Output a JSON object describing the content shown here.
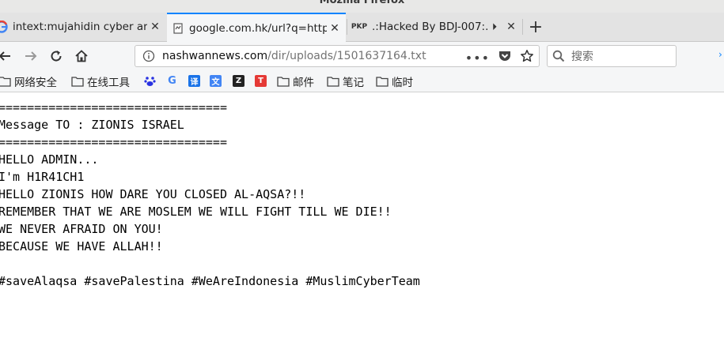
{
  "window": {
    "title": "Mozilla Firefox"
  },
  "tabs": [
    {
      "favicon": "google-g-icon",
      "label": "intext:mujahidin cyber ar"
    },
    {
      "favicon": "page-icon",
      "label": "google.com.hk/url?q=http"
    },
    {
      "favicon_text": "PKP",
      "label": ".:Hacked By BDJ-007:."
    }
  ],
  "urlbar": {
    "host": "nashwannews.com",
    "path": "/dir/uploads/1501637164.txt"
  },
  "search": {
    "placeholder": "搜索"
  },
  "bookmarks": {
    "items": [
      {
        "label": "网络安全",
        "icon": "folder-icon"
      },
      {
        "label": "在线工具",
        "icon": "folder-icon"
      },
      {
        "label": "",
        "icon": "baidu-icon"
      },
      {
        "label": "",
        "icon": "google-icon"
      },
      {
        "label": "",
        "icon": "translate-icon"
      },
      {
        "label": "",
        "icon": "google-translate-icon"
      },
      {
        "label": "",
        "icon": "zhihu-icon"
      },
      {
        "label": "",
        "icon": "red-app-icon"
      },
      {
        "label": "邮件",
        "icon": "folder-icon"
      },
      {
        "label": "笔记",
        "icon": "folder-icon"
      },
      {
        "label": "临时",
        "icon": "folder-icon"
      }
    ]
  },
  "content": {
    "lines": [
      "================================",
      "Message TO : ZIONIS ISRAEL",
      "================================",
      "HELLO ADMIN...",
      "I'm H1R41CH1",
      "HELLO ZIONIS HOW DARE YOU CLOSED AL-AQSA?!!",
      "REMEMBER THAT WE ARE MOSLEM WE WILL FIGHT TILL WE DIE!!",
      "WE NEVER AFRAID ON YOU!",
      "BECAUSE WE HAVE ALLAH!!",
      "",
      "#saveAlaqsa #savePalestina #WeAreIndonesia #MuslimCyberTeam"
    ]
  },
  "colors": {
    "accent": "#0a84ff"
  }
}
